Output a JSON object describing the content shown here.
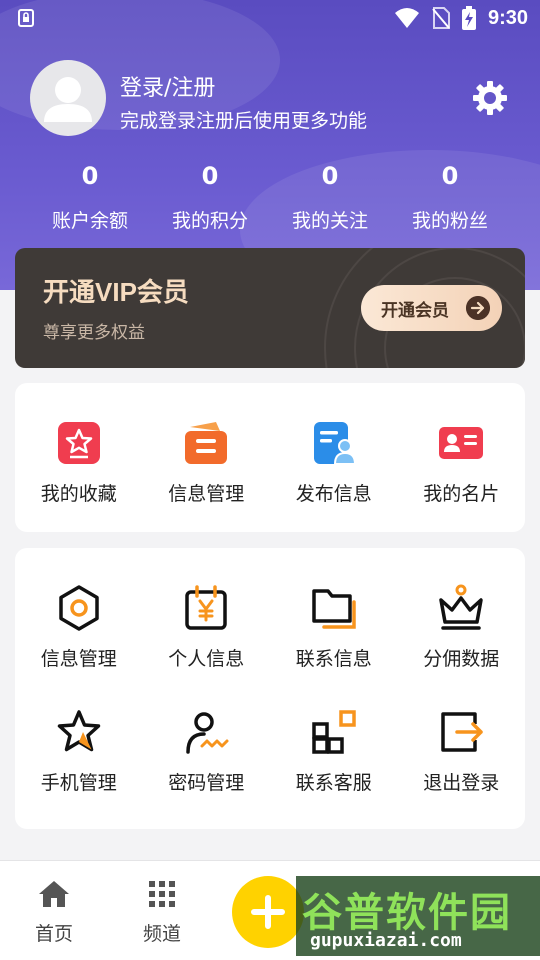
{
  "status_bar": {
    "time": "9:30",
    "left_icon": "lock-sim-icon",
    "right_icons": [
      "wifi-icon",
      "no-sim-icon",
      "battery-charging-icon"
    ]
  },
  "profile": {
    "avatar_icon": "user-avatar-icon",
    "title": "登录/注册",
    "subtitle": "完成登录注册后使用更多功能",
    "settings_icon": "gear-icon"
  },
  "stats": [
    {
      "value": "0",
      "label": "账户余额"
    },
    {
      "value": "0",
      "label": "我的积分"
    },
    {
      "value": "0",
      "label": "我的关注"
    },
    {
      "value": "0",
      "label": "我的粉丝"
    }
  ],
  "vip": {
    "title": "开通VIP会员",
    "subtitle": "尊享更多权益",
    "button_label": "开通会员",
    "button_icon": "arrow-right-icon"
  },
  "quick_menu": [
    {
      "label": "我的收藏",
      "icon": "favorite-star-icon",
      "color": "#f03d4f"
    },
    {
      "label": "信息管理",
      "icon": "info-manage-icon",
      "color": "#f26b2b"
    },
    {
      "label": "发布信息",
      "icon": "publish-doc-icon",
      "color": "#2b8de8"
    },
    {
      "label": "我的名片",
      "icon": "business-card-icon",
      "color": "#f03d4f"
    }
  ],
  "tools_menu": [
    {
      "label": "信息管理",
      "icon": "hexagon-icon"
    },
    {
      "label": "个人信息",
      "icon": "calendar-yen-icon"
    },
    {
      "label": "联系信息",
      "icon": "folder-icon"
    },
    {
      "label": "分佣数据",
      "icon": "crown-icon"
    },
    {
      "label": "手机管理",
      "icon": "star-outline-icon"
    },
    {
      "label": "密码管理",
      "icon": "signature-icon"
    },
    {
      "label": "联系客服",
      "icon": "grid-apps-icon"
    },
    {
      "label": "退出登录",
      "icon": "logout-icon"
    }
  ],
  "tabbar": {
    "items": [
      {
        "label": "首页",
        "icon": "home-icon"
      },
      {
        "label": "频道",
        "icon": "grid-icon"
      }
    ],
    "fab_icon": "plus-icon"
  },
  "watermark": {
    "text": "谷普软件园",
    "url": "gupuxiazai.com"
  },
  "colors": {
    "header": "#5a4cc0",
    "accent": "#f7941d",
    "fab": "#ffd200",
    "vip_bg": "#3f3a37"
  }
}
